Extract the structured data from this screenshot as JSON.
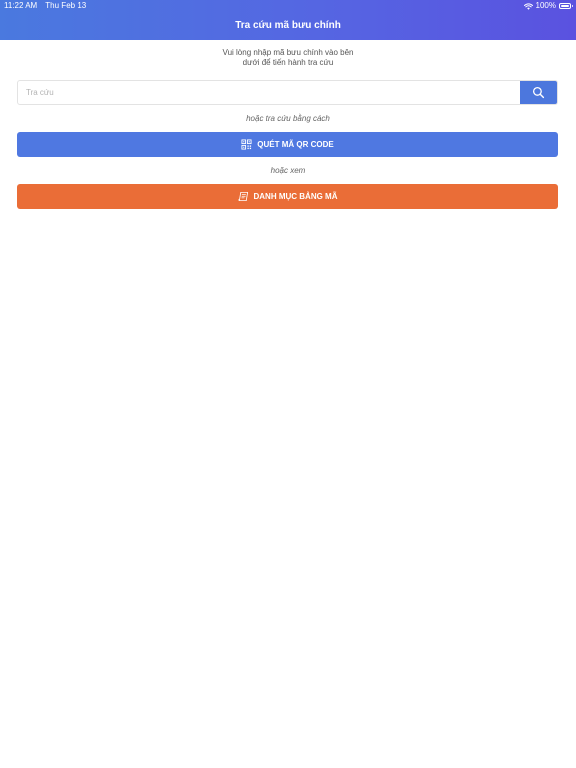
{
  "status_bar": {
    "time": "11:22 AM",
    "date": "Thu Feb 13",
    "battery": "100%"
  },
  "header": {
    "title": "Tra cứu mã bưu chính"
  },
  "instructions": {
    "line1": "Vui lòng nhập mã bưu chính vào bên",
    "line2": "dưới để tiến hành tra cứu"
  },
  "search": {
    "placeholder": "Tra cứu",
    "value": "",
    "icon": "search-icon"
  },
  "alt_text_1": "hoặc tra cứu bằng cách",
  "qr_button": {
    "label": "QUÉT MÃ QR CODE",
    "icon": "qr-code-icon"
  },
  "alt_text_2": "hoặc xem",
  "catalog_button": {
    "label": "DANH MỤC BẢNG MÃ",
    "icon": "book-list-icon"
  },
  "colors": {
    "header_gradient_start": "#4a79df",
    "header_gradient_end": "#5a52e0",
    "primary_blue": "#4f78e1",
    "accent_orange": "#ea6d37"
  }
}
